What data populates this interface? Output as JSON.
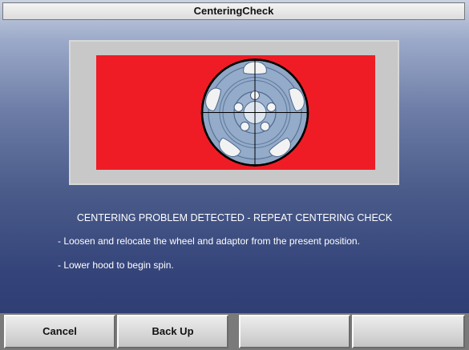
{
  "window": {
    "title": "CenteringCheck"
  },
  "diagram": {
    "background_color": "#ef1c26",
    "panel_color": "#c8c8c8"
  },
  "message": {
    "title": "CENTERING PROBLEM DETECTED - REPEAT CENTERING CHECK",
    "lines": [
      "- Loosen and relocate the wheel and adaptor from the present position.",
      "- Lower hood to begin spin."
    ]
  },
  "buttons": [
    {
      "label": "Cancel"
    },
    {
      "label": "Back Up"
    },
    {
      "label": ""
    },
    {
      "label": ""
    }
  ]
}
